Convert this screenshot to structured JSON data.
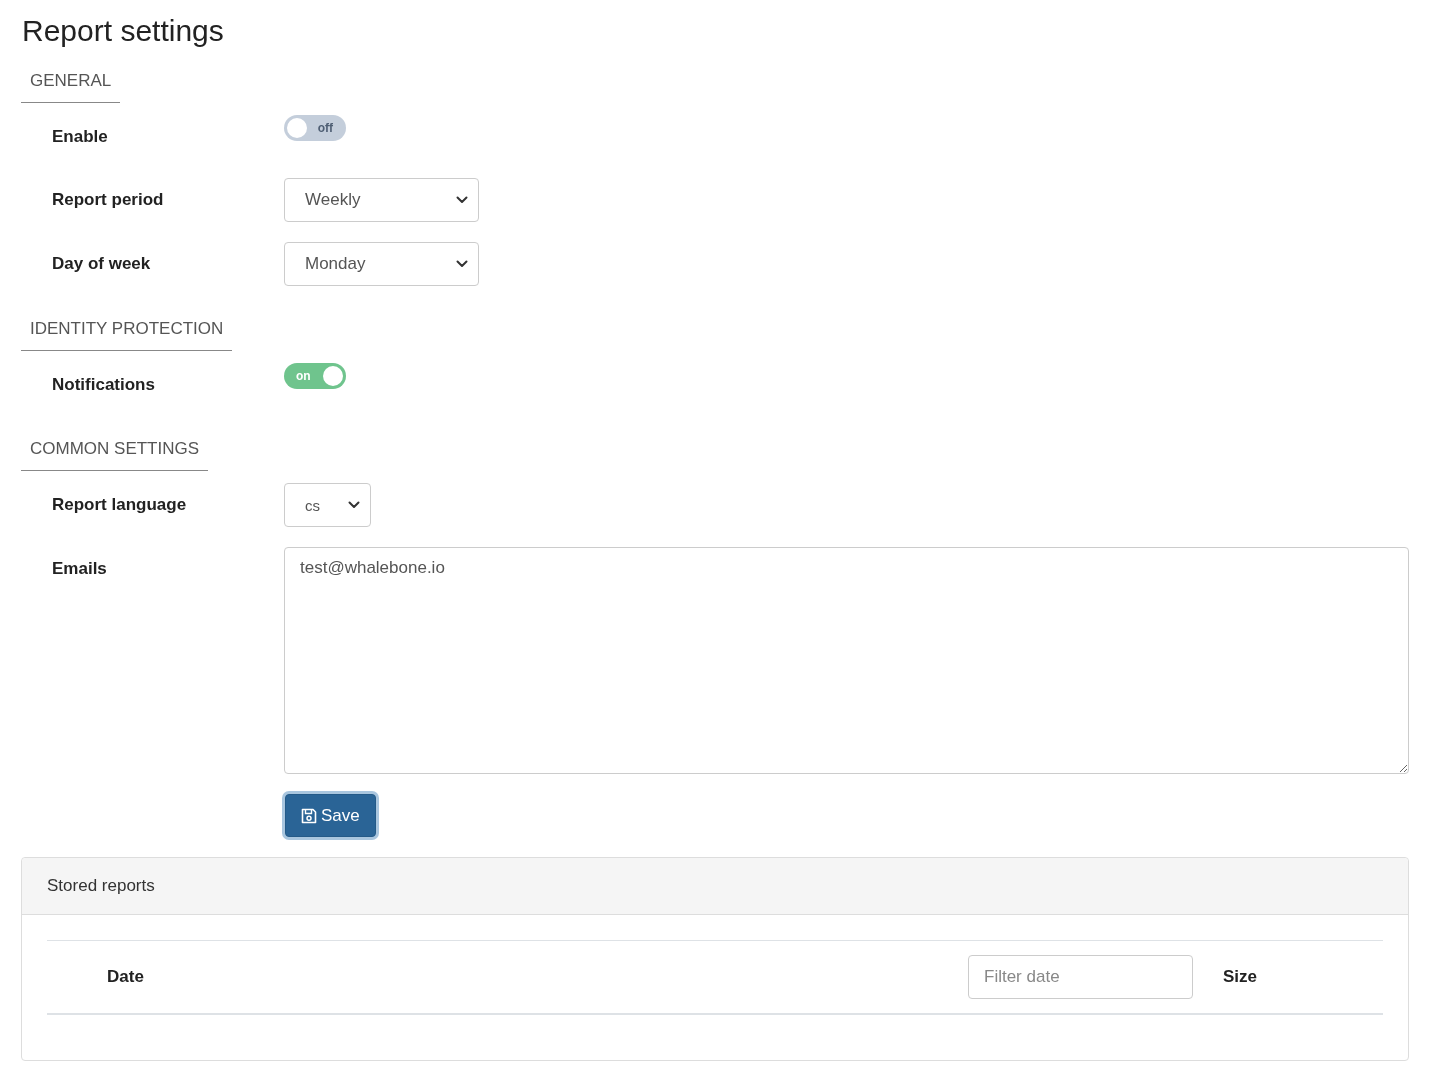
{
  "page": {
    "title": "Report settings"
  },
  "sections": [
    {
      "heading": "GENERAL",
      "fields": [
        {
          "kind": "toggle",
          "label": "Enable",
          "on": false,
          "text": "off"
        },
        {
          "kind": "select",
          "label": "Report period",
          "value": "Weekly"
        },
        {
          "kind": "select",
          "label": "Day of week",
          "value": "Monday"
        }
      ]
    },
    {
      "heading": "IDENTITY PROTECTION",
      "fields": [
        {
          "kind": "toggle",
          "label": "Notifications",
          "on": true,
          "text": "on"
        }
      ]
    },
    {
      "heading": "COMMON SETTINGS",
      "fields": [
        {
          "kind": "select",
          "label": "Report language",
          "value": "cs"
        },
        {
          "kind": "textarea",
          "label": "Emails",
          "value": "test@whalebone.io"
        }
      ]
    }
  ],
  "save_button": {
    "label": "Save"
  },
  "stored_reports": {
    "title": "Stored reports",
    "table": {
      "columns": [
        {
          "label": "Date",
          "filter": {
            "placeholder": "Filter date"
          }
        },
        {
          "label": "Size"
        }
      ]
    }
  }
}
